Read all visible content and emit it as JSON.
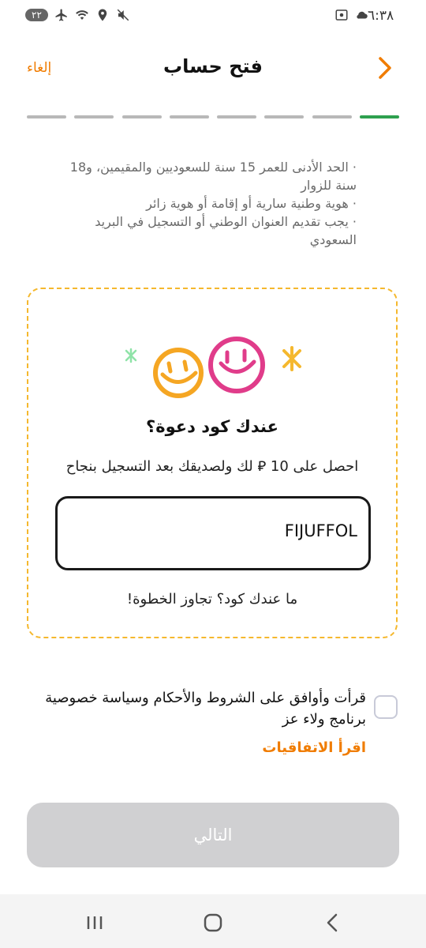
{
  "status_bar": {
    "time": "٦:٣٨",
    "badge": "٢٢"
  },
  "header": {
    "title": "فتح حساب",
    "cancel_label": "إلغاء"
  },
  "progress": {
    "total_steps": 8,
    "current_step": 1
  },
  "requirements": [
    "· الحد الأدنى للعمر 15 سنة للسعوديين والمقيمين، و18 سنة للزوار",
    "· هوية وطنية سارية أو إقامة أو هوية زائر",
    "· يجب تقديم العنوان الوطني أو التسجيل في البريد السعودي"
  ],
  "invite": {
    "title": "عندك كود دعوة؟",
    "subtitle": "احصل على 10 ⃁ لك ولصديقك بعد التسجيل بنجاح",
    "code_value": "FIJUFFOL",
    "skip_label": "ما عندك كود؟ تجاوز الخطوة!"
  },
  "terms": {
    "text": "قرأت وأوافق على الشروط والأحكام وسياسة خصوصية برنامج ولاء عز",
    "read_link": "اقرأ الاتفاقيات",
    "checked": false
  },
  "next_button": {
    "label": "التالي",
    "enabled": false
  },
  "colors": {
    "accent_orange": "#f07c00",
    "progress_active": "#2ea04f",
    "dashed_border": "#f5b82e",
    "smile_yellow": "#f5a623",
    "smile_pink": "#e03c8a",
    "star_green": "#8fe3a8",
    "star_yellow": "#f5b82e"
  },
  "icons": {
    "back": "chevron-right-icon",
    "recents": "recents-icon",
    "home": "home-icon",
    "nav_back": "nav-back-icon"
  }
}
